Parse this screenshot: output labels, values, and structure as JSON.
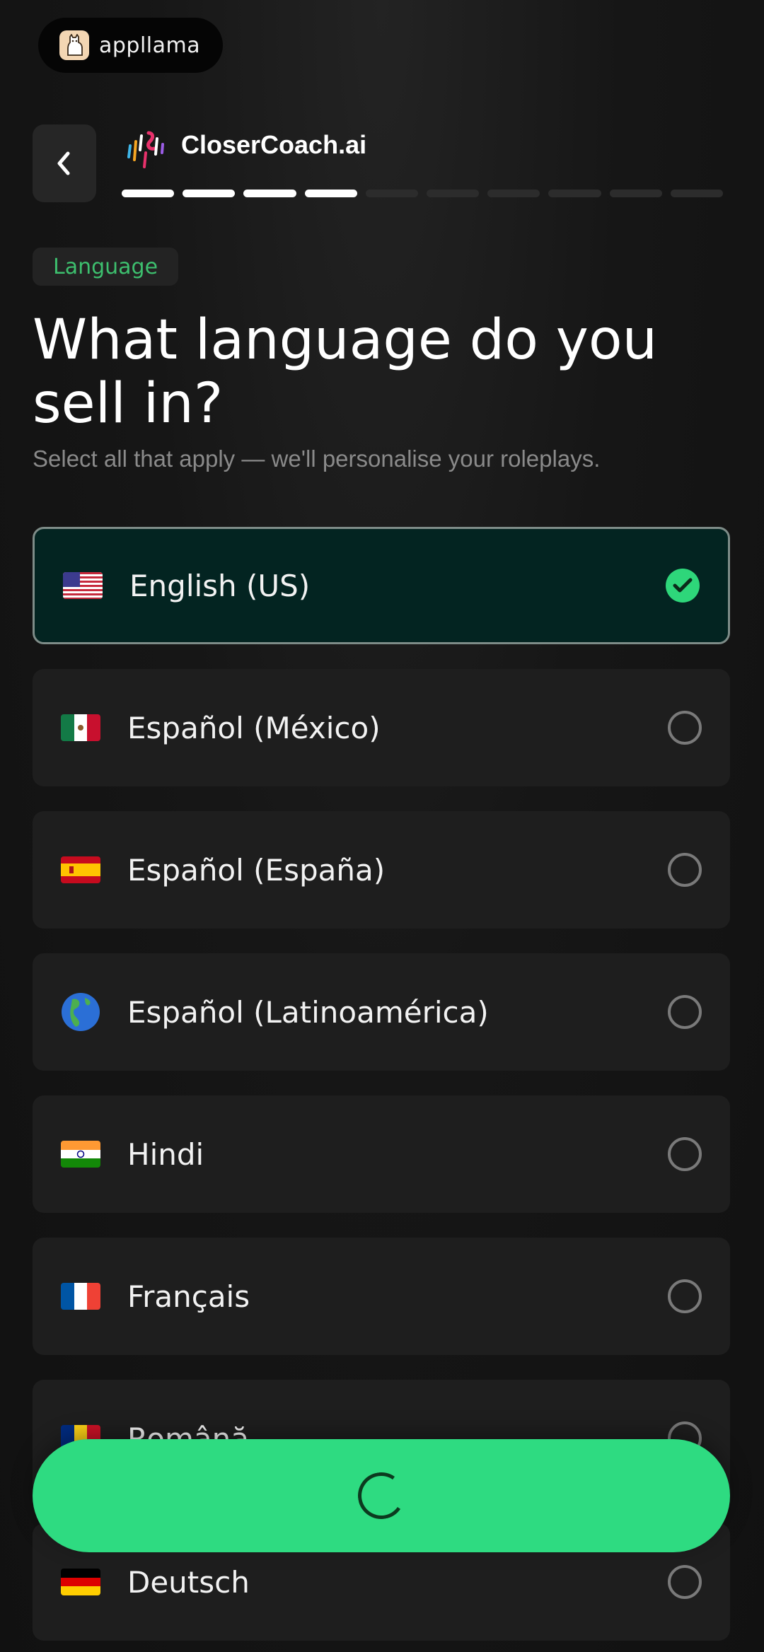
{
  "brand": {
    "name": "appllama",
    "logo_icon": "llama-icon",
    "logo_color": "#f3d6b3"
  },
  "header": {
    "back_icon": "chevron-left-icon",
    "app_logo_icon": "closercoach-logo-icon",
    "title": "CloserCoach.ai",
    "progress": {
      "completed_steps": 4,
      "total_steps": 10
    }
  },
  "main": {
    "tag": "Language",
    "question": "What language do you sell in?",
    "subtitle": "Select all that apply — we'll personalise your roleplays."
  },
  "options": [
    {
      "label": "English (US)",
      "flag_icon": "us-flag-icon",
      "selected": true
    },
    {
      "label": "Español (México)",
      "flag_icon": "mexico-flag-icon",
      "selected": false
    },
    {
      "label": "Español (España)",
      "flag_icon": "spain-flag-icon",
      "selected": false
    },
    {
      "label": "Español (Latinoamérica)",
      "flag_icon": "globe-americas-icon",
      "selected": false
    },
    {
      "label": "Hindi",
      "flag_icon": "india-flag-icon",
      "selected": false
    },
    {
      "label": "Français",
      "flag_icon": "france-flag-icon",
      "selected": false
    },
    {
      "label": "Română",
      "flag_icon": "romania-flag-icon",
      "selected": false
    },
    {
      "label": "Deutsch",
      "flag_icon": "germany-flag-icon",
      "selected": false
    }
  ],
  "cta": {
    "state": "loading",
    "icon": "loading-spinner-icon",
    "color": "#2edb81"
  },
  "colors": {
    "accent": "#2edb81",
    "tag_text": "#3dbf6e",
    "selected_bg": "#032421"
  }
}
